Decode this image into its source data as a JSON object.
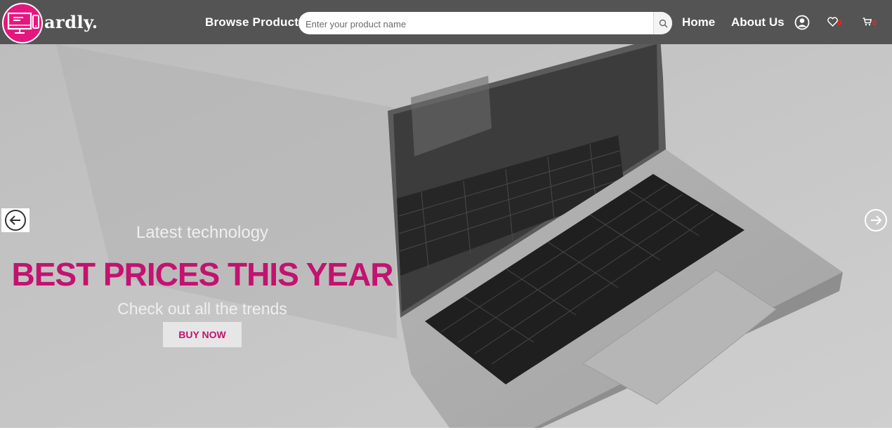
{
  "brand": {
    "name": "ardly.",
    "logo_icon": "devices-logo-icon"
  },
  "nav": {
    "browse_label": "Browse Products",
    "home_label": "Home",
    "about_label": "About Us",
    "wishlist_count": "0",
    "cart_count": "0"
  },
  "search": {
    "placeholder": "Enter your product name",
    "value": ""
  },
  "hero": {
    "eyebrow": "Latest technology",
    "headline": "BEST PRICES THIS YEAR",
    "subline": "Check out all the trends",
    "cta_label": "BUY NOW"
  },
  "colors": {
    "accent": "#e5167f",
    "headline": "#c2136f",
    "header_bg": "#545454",
    "badge": "#ff2020"
  },
  "icons": [
    "search-icon",
    "user-icon",
    "heart-icon",
    "cart-icon",
    "arrow-left-icon",
    "arrow-right-icon"
  ]
}
